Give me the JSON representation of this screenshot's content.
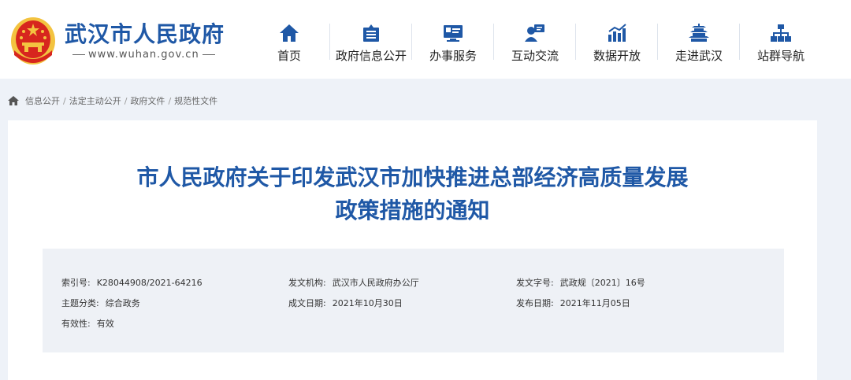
{
  "header": {
    "site_title": "武汉市人民政府",
    "site_url": "www.wuhan.gov.cn"
  },
  "nav": [
    {
      "label": "首页",
      "icon": "home-icon"
    },
    {
      "label": "政府信息公开",
      "icon": "info-disclosure-icon"
    },
    {
      "label": "办事服务",
      "icon": "services-icon"
    },
    {
      "label": "互动交流",
      "icon": "interaction-icon"
    },
    {
      "label": "数据开放",
      "icon": "data-chart-icon"
    },
    {
      "label": "走进武汉",
      "icon": "tower-icon"
    },
    {
      "label": "站群导航",
      "icon": "sitemap-icon"
    }
  ],
  "breadcrumb": [
    "信息公开",
    "法定主动公开",
    "政府文件",
    "规范性文件"
  ],
  "document": {
    "title_line1": "市人民政府关于印发武汉市加快推进总部经济高质量发展",
    "title_line2": "政策措施的通知"
  },
  "meta": {
    "index_no_label": "索引号:",
    "index_no": "K28044908/2021-64216",
    "issuer_label": "发文机构:",
    "issuer": "武汉市人民政府办公厅",
    "doc_no_label": "发文字号:",
    "doc_no": "武政规〔2021〕16号",
    "category_label": "主题分类:",
    "category": "综合政务",
    "created_label": "成文日期:",
    "created": "2021年10月30日",
    "published_label": "发布日期:",
    "published": "2021年11月05日",
    "validity_label": "有效性:",
    "validity": "有效"
  },
  "colors": {
    "brand_blue": "#1f58a6",
    "emblem_red": "#d7261e",
    "emblem_gold": "#f3c340"
  }
}
